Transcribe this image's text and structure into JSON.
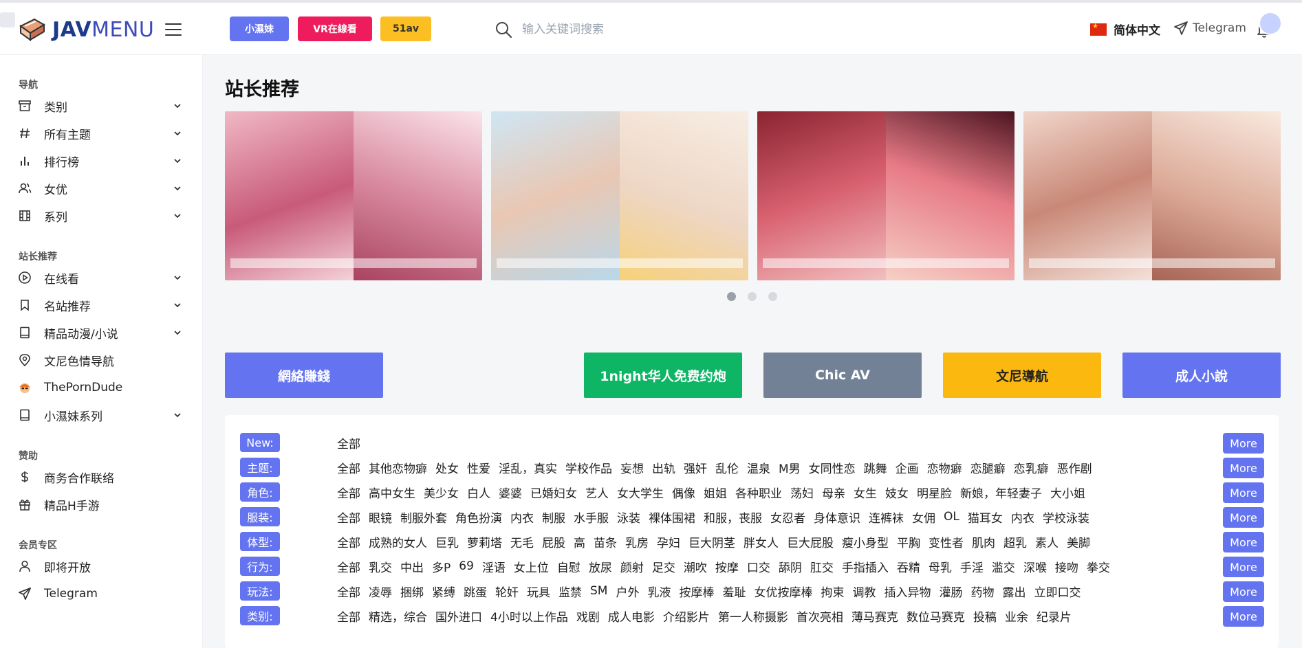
{
  "header": {
    "logo_bold": "JAV",
    "logo_light": "MENU",
    "pills": [
      {
        "label": "小濕妹",
        "color": "#6474f0"
      },
      {
        "label": "VR在線看",
        "color": "#ee1c5c"
      },
      {
        "label": "51av",
        "color": "#fbbf24"
      }
    ],
    "search_placeholder": "输入关键词搜索",
    "language": "简体中文",
    "telegram": "Telegram"
  },
  "sidebar": {
    "sections": [
      {
        "title": "导航",
        "items": [
          {
            "label": "类别",
            "icon": "archive-icon",
            "expand": true
          },
          {
            "label": "所有主题",
            "icon": "hashtag-icon",
            "expand": true
          },
          {
            "label": "排行榜",
            "icon": "bar-chart-icon",
            "expand": true
          },
          {
            "label": "女优",
            "icon": "users-icon",
            "expand": true
          },
          {
            "label": "系列",
            "icon": "film-icon",
            "expand": true
          }
        ]
      },
      {
        "title": "站长推荐",
        "items": [
          {
            "label": "在线看",
            "icon": "play-circle-icon",
            "expand": true
          },
          {
            "label": "名站推荐",
            "icon": "bookmark-icon",
            "expand": true
          },
          {
            "label": "精品动漫/小说",
            "icon": "book-icon",
            "expand": true
          },
          {
            "label": "文尼色情导航",
            "icon": "map-pin-icon",
            "expand": false
          },
          {
            "label": "ThePornDude",
            "icon": "porndude-icon",
            "expand": false
          },
          {
            "label": "小濕妹系列",
            "icon": "book-icon",
            "expand": true
          }
        ]
      },
      {
        "title": "赞助",
        "items": [
          {
            "label": "商务合作联络",
            "icon": "dollar-icon",
            "expand": false
          },
          {
            "label": "精品H手游",
            "icon": "gift-icon",
            "expand": false
          }
        ]
      },
      {
        "title": "会员专区",
        "items": [
          {
            "label": "即将开放",
            "icon": "user-icon",
            "expand": false
          },
          {
            "label": "Telegram",
            "icon": "send-icon",
            "expand": false
          }
        ]
      }
    ]
  },
  "main": {
    "title": "站长推荐",
    "carousel_pages": 3,
    "carousel_active": 1,
    "buttons": [
      {
        "label": "網絡賺錢",
        "color": "#6474f0"
      },
      {
        "label": "1night华人免费约炮",
        "color": "#0db565"
      },
      {
        "label": "Chic AV",
        "color": "#738197"
      },
      {
        "label": "文尼導航",
        "color": "#fbb80f"
      },
      {
        "label": "成人小說",
        "color": "#6474f0"
      }
    ]
  },
  "filters": {
    "more_label": "More",
    "rows": [
      {
        "tag": "New:",
        "items": [
          "全部"
        ]
      },
      {
        "tag": "主题:",
        "items": [
          "全部",
          "其他恋物癖",
          "处女",
          "性爱",
          "淫乱，真实",
          "学校作品",
          "妄想",
          "出轨",
          "强奸",
          "乱伦",
          "温泉",
          "M男",
          "女同性恋",
          "跳舞",
          "企画",
          "恋物癖",
          "恋腿癖",
          "恋乳癖",
          "恶作剧"
        ]
      },
      {
        "tag": "角色:",
        "items": [
          "全部",
          "高中女生",
          "美少女",
          "白人",
          "婆婆",
          "已婚妇女",
          "艺人",
          "女大学生",
          "偶像",
          "姐姐",
          "各种职业",
          "荡妇",
          "母亲",
          "女生",
          "妓女",
          "明星脸",
          "新娘，年轻妻子",
          "大小姐"
        ]
      },
      {
        "tag": "服装:",
        "items": [
          "全部",
          "眼镜",
          "制服外套",
          "角色扮演",
          "内衣",
          "制服",
          "水手服",
          "泳装",
          "裸体围裙",
          "和服，丧服",
          "女忍者",
          "身体意识",
          "连裤袜",
          "女佣",
          "OL",
          "猫耳女",
          "内衣",
          "学校泳装"
        ]
      },
      {
        "tag": "体型:",
        "items": [
          "全部",
          "成熟的女人",
          "巨乳",
          "萝莉塔",
          "无毛",
          "屁股",
          "高",
          "苗条",
          "乳房",
          "孕妇",
          "巨大阴茎",
          "胖女人",
          "巨大屁股",
          "瘦小身型",
          "平胸",
          "变性者",
          "肌肉",
          "超乳",
          "素人",
          "美脚"
        ]
      },
      {
        "tag": "行为:",
        "items": [
          "全部",
          "乳交",
          "中出",
          "多P",
          "69",
          "淫语",
          "女上位",
          "自慰",
          "放尿",
          "颜射",
          "足交",
          "潮吹",
          "按摩",
          "口交",
          "舔阴",
          "肛交",
          "手指插入",
          "吞精",
          "母乳",
          "手淫",
          "滥交",
          "深喉",
          "接吻",
          "拳交"
        ]
      },
      {
        "tag": "玩法:",
        "items": [
          "全部",
          "凌辱",
          "捆绑",
          "紧缚",
          "跳蛋",
          "轮奸",
          "玩具",
          "监禁",
          "SM",
          "户外",
          "乳液",
          "按摩棒",
          "羞耻",
          "女优按摩棒",
          "拘束",
          "调教",
          "插入异物",
          "灌肠",
          "药物",
          "露出",
          "立即口交"
        ]
      },
      {
        "tag": "类别:",
        "items": [
          "全部",
          "精选，综合",
          "国外进口",
          "4小时以上作品",
          "戏剧",
          "成人电影",
          "介绍影片",
          "第一人称摄影",
          "首次亮相",
          "薄马赛克",
          "数位马赛克",
          "投稿",
          "业余",
          "纪录片"
        ]
      }
    ]
  },
  "colors": {
    "accent": "#6474f0",
    "brand": "#1e3a8a"
  }
}
